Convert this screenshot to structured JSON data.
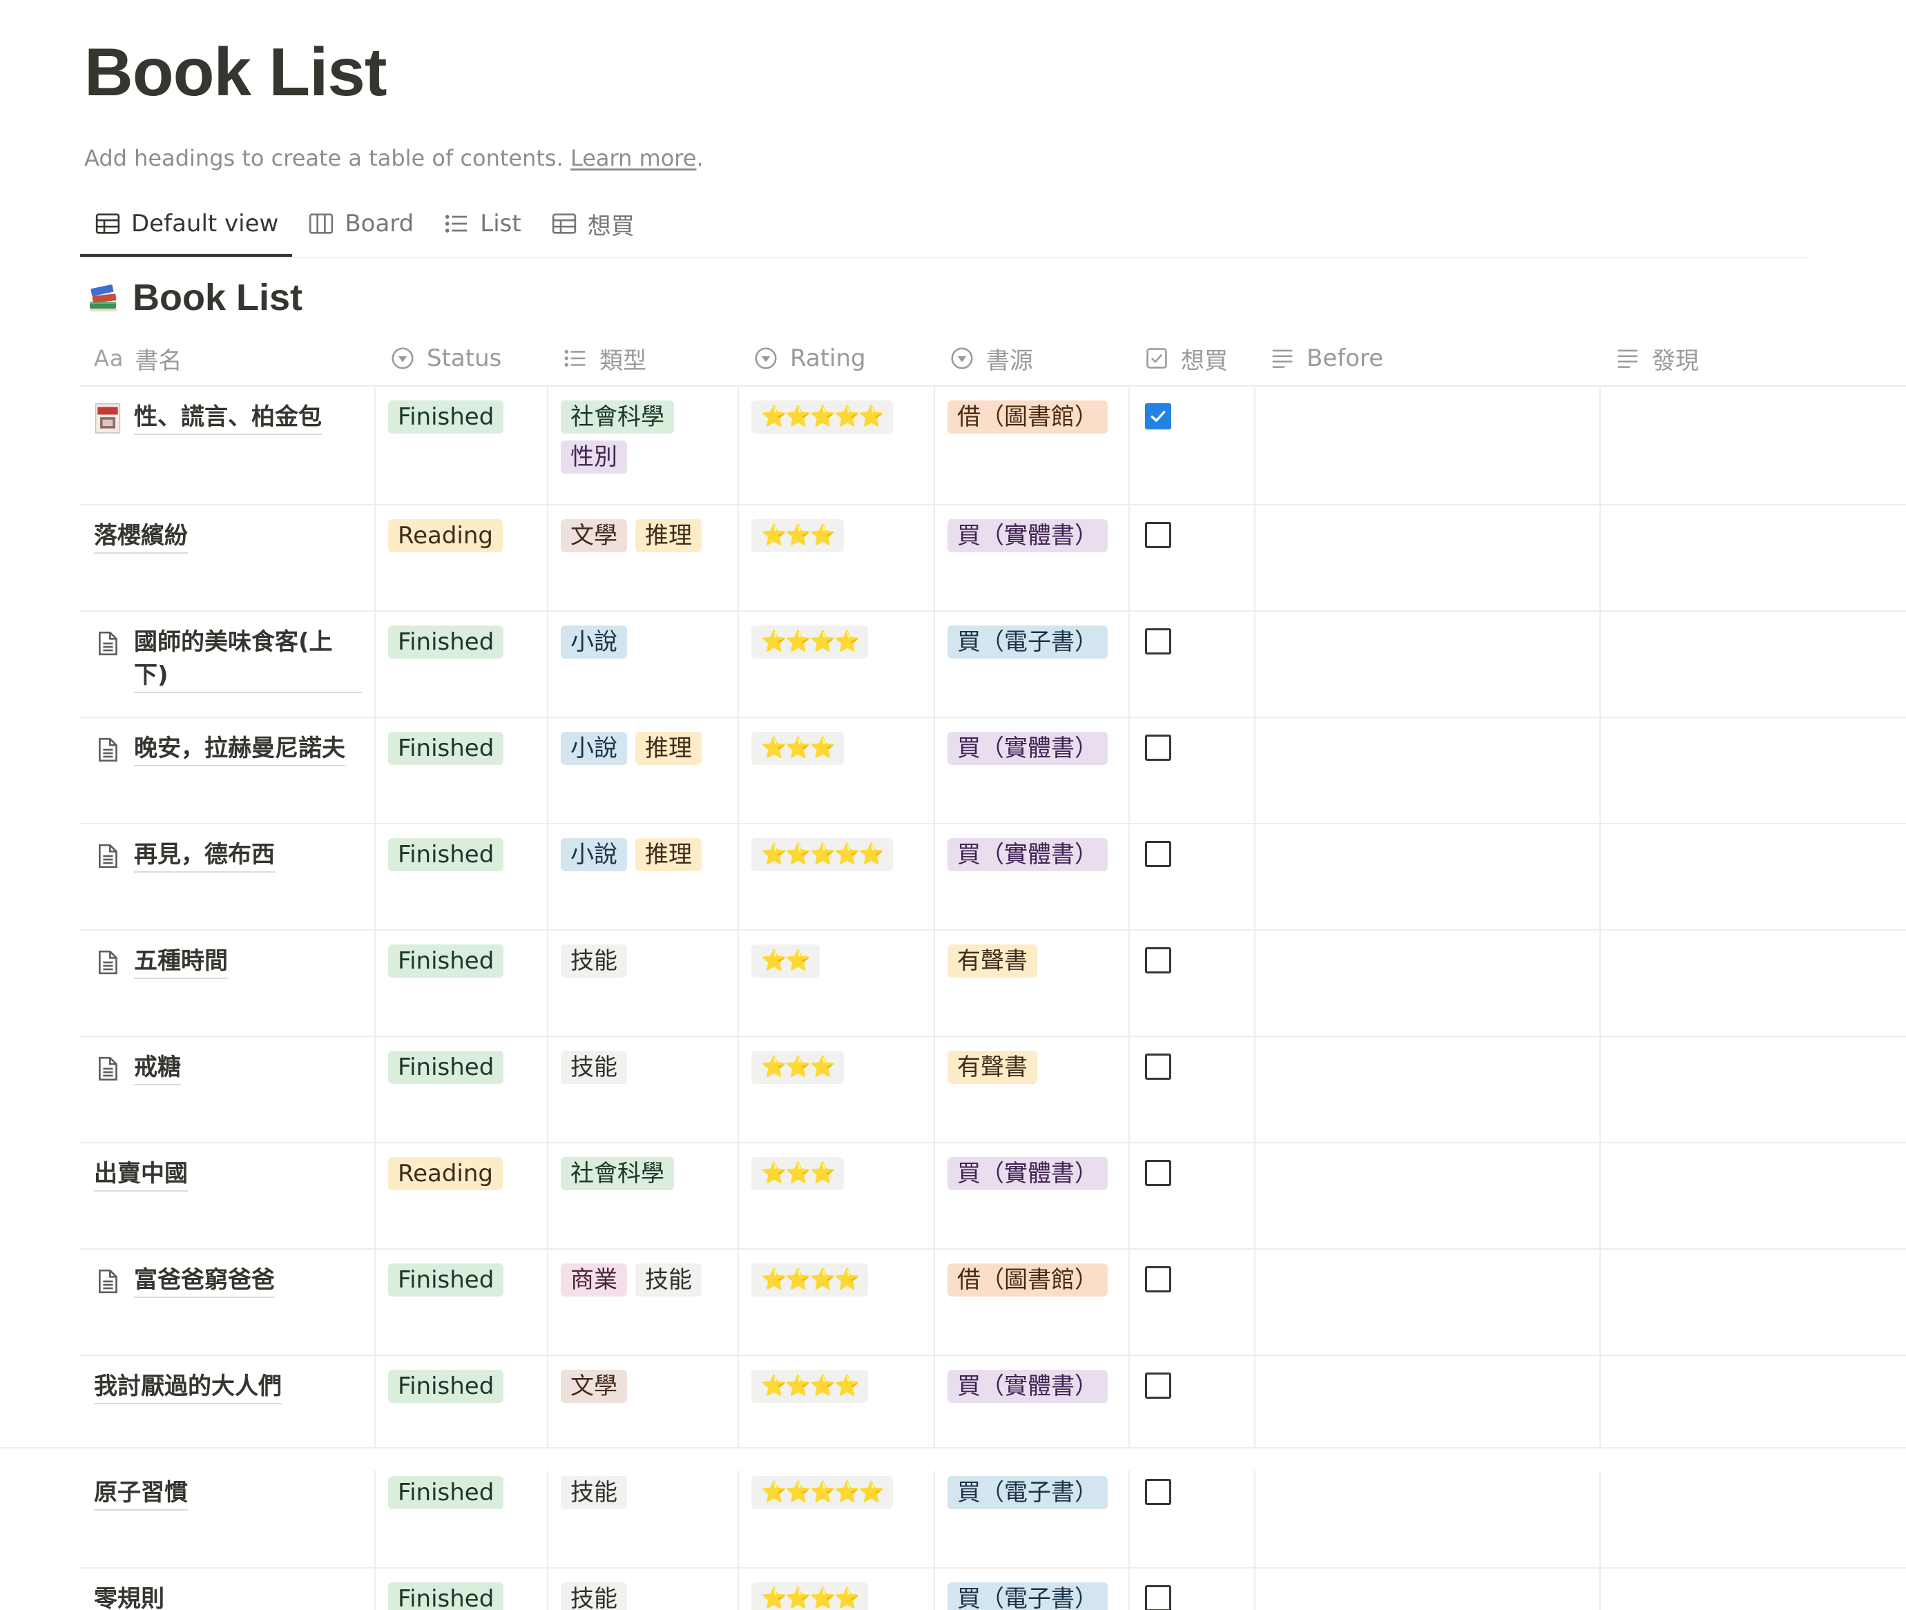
{
  "page": {
    "title": "Book List",
    "toc_hint": "Add headings to create a table of contents.",
    "toc_link": "Learn more",
    "toc_period": "."
  },
  "views": [
    {
      "label": "Default view",
      "icon": "table-icon",
      "active": true
    },
    {
      "label": "Board",
      "icon": "board-icon",
      "active": false
    },
    {
      "label": "List",
      "icon": "list-icon",
      "active": false
    },
    {
      "label": "想買",
      "icon": "table-icon",
      "active": false
    }
  ],
  "database": {
    "title": "Book List",
    "icon": "books-icon"
  },
  "columns": [
    {
      "label": "書名",
      "prefix": "Aa",
      "icon": "title-icon"
    },
    {
      "label": "Status",
      "icon": "select-icon"
    },
    {
      "label": "類型",
      "icon": "multiselect-icon"
    },
    {
      "label": "Rating",
      "icon": "select-icon"
    },
    {
      "label": "書源",
      "icon": "select-icon"
    },
    {
      "label": "想買",
      "icon": "checkbox-icon"
    },
    {
      "label": "Before",
      "icon": "text-icon"
    },
    {
      "label": "發現",
      "icon": "text-icon"
    }
  ],
  "colors": {
    "green": "#dbeddb",
    "yellow": "#fdecc8",
    "purple": "#e8deee",
    "orange": "#fadec9",
    "blue": "#d3e5ef",
    "brown": "#eee0da",
    "gray": "#f1f1ef",
    "pink": "#f5e0e9",
    "check_blue": "#2383e2"
  },
  "rows": [
    {
      "name": "性、謊言、柏金包",
      "icon": "book-cover-icon",
      "status": "Finished",
      "status_color": "green",
      "types": [
        {
          "label": "社會科學",
          "color": "green"
        },
        {
          "label": "性別",
          "color": "purple"
        }
      ],
      "rating": "⭐⭐⭐⭐⭐",
      "source": "借（圖書館）",
      "source_color": "orange",
      "want": true
    },
    {
      "name": "落櫻繽紛",
      "icon": "",
      "status": "Reading",
      "status_color": "yellow",
      "types": [
        {
          "label": "文學",
          "color": "brown"
        },
        {
          "label": "推理",
          "color": "yellow"
        }
      ],
      "rating": "⭐⭐⭐",
      "source": "買（實體書）",
      "source_color": "purple",
      "want": false
    },
    {
      "name": "國師的美味食客(上下)",
      "icon": "page-icon",
      "status": "Finished",
      "status_color": "green",
      "types": [
        {
          "label": "小說",
          "color": "blue"
        }
      ],
      "rating": "⭐⭐⭐⭐",
      "source": "買（電子書）",
      "source_color": "blue",
      "want": false
    },
    {
      "name": "晚安，拉赫曼尼諾夫",
      "icon": "page-icon",
      "status": "Finished",
      "status_color": "green",
      "types": [
        {
          "label": "小說",
          "color": "blue"
        },
        {
          "label": "推理",
          "color": "yellow"
        }
      ],
      "rating": "⭐⭐⭐",
      "source": "買（實體書）",
      "source_color": "purple",
      "want": false
    },
    {
      "name": "再見，德布西",
      "icon": "page-icon",
      "status": "Finished",
      "status_color": "green",
      "types": [
        {
          "label": "小說",
          "color": "blue"
        },
        {
          "label": "推理",
          "color": "yellow"
        }
      ],
      "rating": "⭐⭐⭐⭐⭐",
      "source": "買（實體書）",
      "source_color": "purple",
      "want": false
    },
    {
      "name": "五種時間",
      "icon": "page-icon",
      "status": "Finished",
      "status_color": "green",
      "types": [
        {
          "label": "技能",
          "color": "gray"
        }
      ],
      "rating": "⭐⭐",
      "source": "有聲書",
      "source_color": "yellow",
      "want": false
    },
    {
      "name": "戒糖",
      "icon": "page-icon",
      "status": "Finished",
      "status_color": "green",
      "types": [
        {
          "label": "技能",
          "color": "gray"
        }
      ],
      "rating": "⭐⭐⭐",
      "source": "有聲書",
      "source_color": "yellow",
      "want": false
    },
    {
      "name": "出賣中國",
      "icon": "",
      "status": "Reading",
      "status_color": "yellow",
      "types": [
        {
          "label": "社會科學",
          "color": "green"
        }
      ],
      "rating": "⭐⭐⭐",
      "source": "買（實體書）",
      "source_color": "purple",
      "want": false
    },
    {
      "name": "富爸爸窮爸爸",
      "icon": "page-icon",
      "status": "Finished",
      "status_color": "green",
      "types": [
        {
          "label": "商業",
          "color": "pink"
        },
        {
          "label": "技能",
          "color": "gray"
        }
      ],
      "rating": "⭐⭐⭐⭐",
      "source": "借（圖書館）",
      "source_color": "orange",
      "want": false
    },
    {
      "name": "我討厭過的大人們",
      "icon": "",
      "status": "Finished",
      "status_color": "green",
      "types": [
        {
          "label": "文學",
          "color": "brown"
        }
      ],
      "rating": "⭐⭐⭐⭐",
      "source": "買（實體書）",
      "source_color": "purple",
      "want": false
    },
    {
      "name": "原子習慣",
      "icon": "",
      "status": "Finished",
      "status_color": "green",
      "types": [
        {
          "label": "技能",
          "color": "gray"
        }
      ],
      "rating": "⭐⭐⭐⭐⭐",
      "source": "買（電子書）",
      "source_color": "blue",
      "want": false
    },
    {
      "name": "零規則",
      "icon": "",
      "status": "Finished",
      "status_color": "green",
      "types": [
        {
          "label": "技能",
          "color": "gray"
        }
      ],
      "rating": "⭐⭐⭐⭐",
      "source": "買（電子書）",
      "source_color": "blue",
      "want": false
    }
  ]
}
